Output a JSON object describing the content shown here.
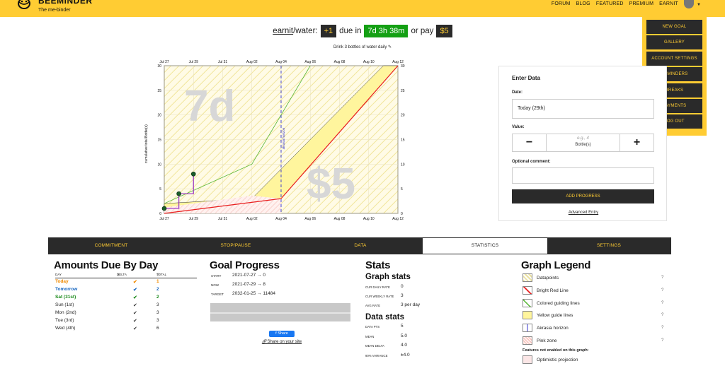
{
  "header": {
    "brand": "BEEMINDER",
    "tagline": "The me-binder",
    "nav": [
      "FORUM",
      "BLOG",
      "FEATURED",
      "PREMIUM",
      "EARNIT"
    ]
  },
  "menu": [
    "NEW GOAL",
    "GALLERY",
    "ACCOUNT SETTINGS",
    "REMINDERS",
    "BREAKS",
    "PAYMENTS",
    "LOG OUT"
  ],
  "goal": {
    "user": "earnit",
    "slug": "/water:",
    "delta": "+1",
    "due_in_label": "due in",
    "due_in": "7d 3h 38m",
    "or_pay": "or pay",
    "pledge": "$5",
    "fineprint": "Drink 3 bottles of water daily"
  },
  "chart_data": {
    "type": "line",
    "title": "",
    "xlabel": "",
    "ylabel": "cumulative total Bottle(s)",
    "x_ticks": [
      "Jul 27",
      "Jul 29",
      "Jul 31",
      "Aug 02",
      "Aug 04",
      "Aug 06",
      "Aug 08",
      "Aug 10",
      "Aug 12"
    ],
    "y_ticks": [
      0,
      5,
      10,
      15,
      20,
      25,
      30
    ],
    "ylim": [
      0,
      30
    ],
    "watermark_time": "7d",
    "watermark_money": "$5",
    "akrasia_label": "akrasia horizon",
    "datapoints": [
      {
        "x": "Jul 27",
        "y": 1
      },
      {
        "x": "Jul 28",
        "y": 4
      },
      {
        "x": "Jul 29",
        "y": 8
      }
    ],
    "series": [
      {
        "name": "Bright Red Line",
        "values": [
          {
            "x": "Jul 27",
            "y": 0
          },
          {
            "x": "Aug 04",
            "y": 3
          },
          {
            "x": "Aug 12",
            "y": 30
          }
        ]
      },
      {
        "name": "Colored guiding lines",
        "values": [
          {
            "x": "Jul 27",
            "y": 2
          },
          {
            "x": "Aug 02",
            "y": 10
          },
          {
            "x": "Aug 06",
            "y": 30
          }
        ]
      }
    ],
    "grid": true
  },
  "entry": {
    "heading": "Enter Data",
    "date_label": "Date:",
    "date_value": "Today (29th)",
    "value_label": "Value:",
    "minus": "−",
    "plus": "+",
    "example": "e.g., 4",
    "unit": "Bottle(s)",
    "comment_label": "Optional comment:",
    "add": "ADD PROGRESS",
    "advanced": "Advanced Entry"
  },
  "tabs": [
    "COMMITMENT",
    "STOP/PAUSE",
    "DATA",
    "STATISTICS",
    "SETTINGS"
  ],
  "amounts": {
    "title": "Amounts Due By Day",
    "cols": [
      "DAY",
      "DELTA",
      "TOTAL"
    ],
    "rows": [
      {
        "day": "Today",
        "check": "✔",
        "total": "1"
      },
      {
        "day": "Tomorrow",
        "check": "✔",
        "total": "2"
      },
      {
        "day": "Sat (31st)",
        "check": "✔",
        "total": "2"
      },
      {
        "day": "Sun (1st)",
        "check": "✔",
        "total": "3"
      },
      {
        "day": "Mon (2nd)",
        "check": "✔",
        "total": "3"
      },
      {
        "day": "Tue (3rd)",
        "check": "✔",
        "total": "3"
      },
      {
        "day": "Wed (4th)",
        "check": "✔",
        "total": "6"
      }
    ]
  },
  "progress": {
    "title": "Goal Progress",
    "rows": [
      {
        "k": "START",
        "v": "2021-07-27 → 0"
      },
      {
        "k": "NOW",
        "v": "2021-07-29 → 8"
      },
      {
        "k": "TARGET",
        "v": "2032-01-25 → 11484"
      }
    ],
    "share": "Share",
    "share_site": "Share on your site"
  },
  "stats": {
    "title": "Stats",
    "graph_title": "Graph stats",
    "graph_rows": [
      {
        "k": "CUR DAILY RATE",
        "v": "0"
      },
      {
        "k": "CUR WEEKLY RATE",
        "v": "3"
      },
      {
        "k": "AVG RATE",
        "v": "3 per day"
      }
    ],
    "data_title": "Data stats",
    "data_rows": [
      {
        "k": "DATA PTS",
        "v": "5"
      },
      {
        "k": "MEAN",
        "v": "5.0"
      },
      {
        "k": "MEAN DELTA",
        "v": "4.0"
      },
      {
        "k": "90% VARIANCE",
        "v": "±4.0"
      }
    ]
  },
  "legend": {
    "title": "Graph Legend",
    "items": [
      "Datapoints",
      "Bright Red Line",
      "Colored guiding lines",
      "Yellow guide lines",
      "Akrasia horizon",
      "Pink zone"
    ],
    "note": "Features not enabled on this graph:",
    "disabled": [
      "Optimistic projection"
    ],
    "help": "?"
  }
}
